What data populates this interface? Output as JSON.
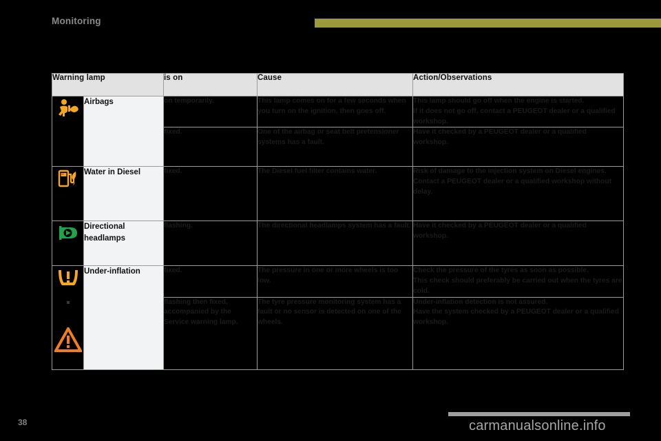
{
  "header": {
    "chapter_title": "Monitoring",
    "rule_color": "#9a9a3d"
  },
  "table": {
    "columns": [
      "Warning lamp",
      "is on",
      "Cause",
      "Action/Observations"
    ],
    "rows": [
      {
        "icon": "airbag-icon",
        "icon_color": "#f5a623",
        "lamp": "Airbags",
        "entries": [
          {
            "is_on": "on temporarily.",
            "cause": "This lamp comes on for a few seconds when you turn on the ignition, then goes off.",
            "action": "This lamp should go off when the engine is started.\nIf it does not go off, contact a PEUGEOT dealer or a qualified workshop."
          },
          {
            "is_on": "fixed.",
            "cause": "One of the airbag or seat belt pretensioner systems has a fault.",
            "action": "Have it checked by a PEUGEOT dealer or a qualified workshop."
          }
        ]
      },
      {
        "icon": "water-in-diesel-icon",
        "icon_color": "#f5a623",
        "lamp": "Water in Diesel",
        "entries": [
          {
            "is_on": "fixed.",
            "cause": "The Diesel fuel filter contains water.",
            "action": "Risk of damage to the injection system on Diesel engines.\nContact a PEUGEOT dealer or a qualified workshop without delay."
          }
        ]
      },
      {
        "icon": "directional-headlamps-icon",
        "icon_color": "#22a24a",
        "lamp": "Directional headlamps",
        "entries": [
          {
            "is_on": "flashing.",
            "cause": "The directional headlamps system has a fault.",
            "action": "Have it checked by a PEUGEOT dealer or a qualified workshop."
          }
        ]
      },
      {
        "icon": "under-inflation-icon",
        "icon_color": "#f5a623",
        "secondary_icon": "service-warning-triangle-icon",
        "secondary_icon_color": "#ef7d22",
        "lamp": "Under-inflation",
        "entries": [
          {
            "is_on": "fixed.",
            "cause": "The pressure in one or more wheels is too low.",
            "action": "Check the pressure of the tyres as soon as possible.\nThis check should preferably be carried out when the tyres are cold."
          },
          {
            "is_on": "flashing then fixed, accompanied by the Service warning lamp.",
            "cause": "The tyre pressure monitoring system has a fault or no sensor is detected on one of the wheels.",
            "action": "Under-inflation detection is not assured.\nHave the system checked by a PEUGEOT dealer or a qualified workshop."
          }
        ]
      }
    ]
  },
  "footer": {
    "page_number": "38",
    "watermark": "carmanualsonline.info"
  }
}
